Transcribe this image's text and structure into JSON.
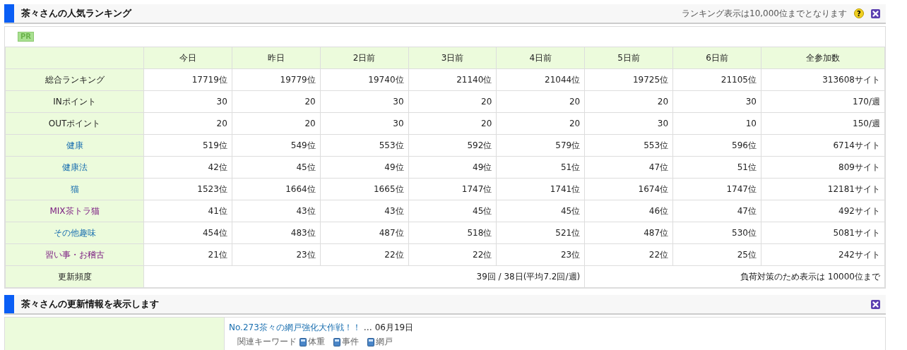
{
  "ranking_panel": {
    "title": "茶々さんの人気ランキング",
    "note": "ランキング表示は10,000位までとなります",
    "help_button": "?",
    "pr_badge": "PR",
    "table": {
      "columns": [
        "今日",
        "昨日",
        "2日前",
        "3日前",
        "4日前",
        "5日前",
        "6日前",
        "全参加数"
      ],
      "rows": [
        {
          "label": "総合ランキング",
          "kind": "text",
          "cells": [
            "17719位",
            "19779位",
            "19740位",
            "21140位",
            "21044位",
            "19725位",
            "21105位",
            "313608サイト"
          ]
        },
        {
          "label": "INポイント",
          "kind": "text",
          "cells": [
            "30",
            "20",
            "30",
            "20",
            "20",
            "20",
            "30",
            "170/週"
          ]
        },
        {
          "label": "OUTポイント",
          "kind": "text",
          "cells": [
            "20",
            "20",
            "30",
            "20",
            "20",
            "30",
            "10",
            "150/週"
          ]
        },
        {
          "label": "健康",
          "kind": "link",
          "visited": false,
          "cells": [
            "519位",
            "549位",
            "553位",
            "592位",
            "579位",
            "553位",
            "596位",
            "6714サイト"
          ]
        },
        {
          "label": "健康法",
          "kind": "link",
          "visited": false,
          "cells": [
            "42位",
            "45位",
            "49位",
            "49位",
            "51位",
            "47位",
            "51位",
            "809サイト"
          ]
        },
        {
          "label": "猫",
          "kind": "link",
          "visited": false,
          "cells": [
            "1523位",
            "1664位",
            "1665位",
            "1747位",
            "1741位",
            "1674位",
            "1747位",
            "12181サイト"
          ]
        },
        {
          "label": "MIX茶トラ猫",
          "kind": "link",
          "visited": true,
          "cells": [
            "41位",
            "43位",
            "43位",
            "45位",
            "45位",
            "46位",
            "47位",
            "492サイト"
          ]
        },
        {
          "label": "その他趣味",
          "kind": "link",
          "visited": false,
          "cells": [
            "454位",
            "483位",
            "487位",
            "518位",
            "521位",
            "487位",
            "530位",
            "5081サイト"
          ]
        },
        {
          "label": "習い事・お稽古",
          "kind": "link",
          "visited": true,
          "cells": [
            "21位",
            "23位",
            "22位",
            "22位",
            "23位",
            "22位",
            "25位",
            "242サイト"
          ]
        }
      ],
      "footer": {
        "label": "更新頻度",
        "frequency": "39回 / 38日(平均7.2回/週)",
        "limit_note": "負荷対策のため表示は 10000位まで"
      }
    }
  },
  "updates_panel": {
    "title": "茶々さんの更新情報を表示します",
    "entries": [
      {
        "title": "No.273茶々の網戸強化大作戦！！",
        "date": "… 06月19日",
        "keywords_label": "関連キーワード",
        "keywords": [
          "体重",
          "事件",
          "網戸"
        ]
      }
    ]
  }
}
